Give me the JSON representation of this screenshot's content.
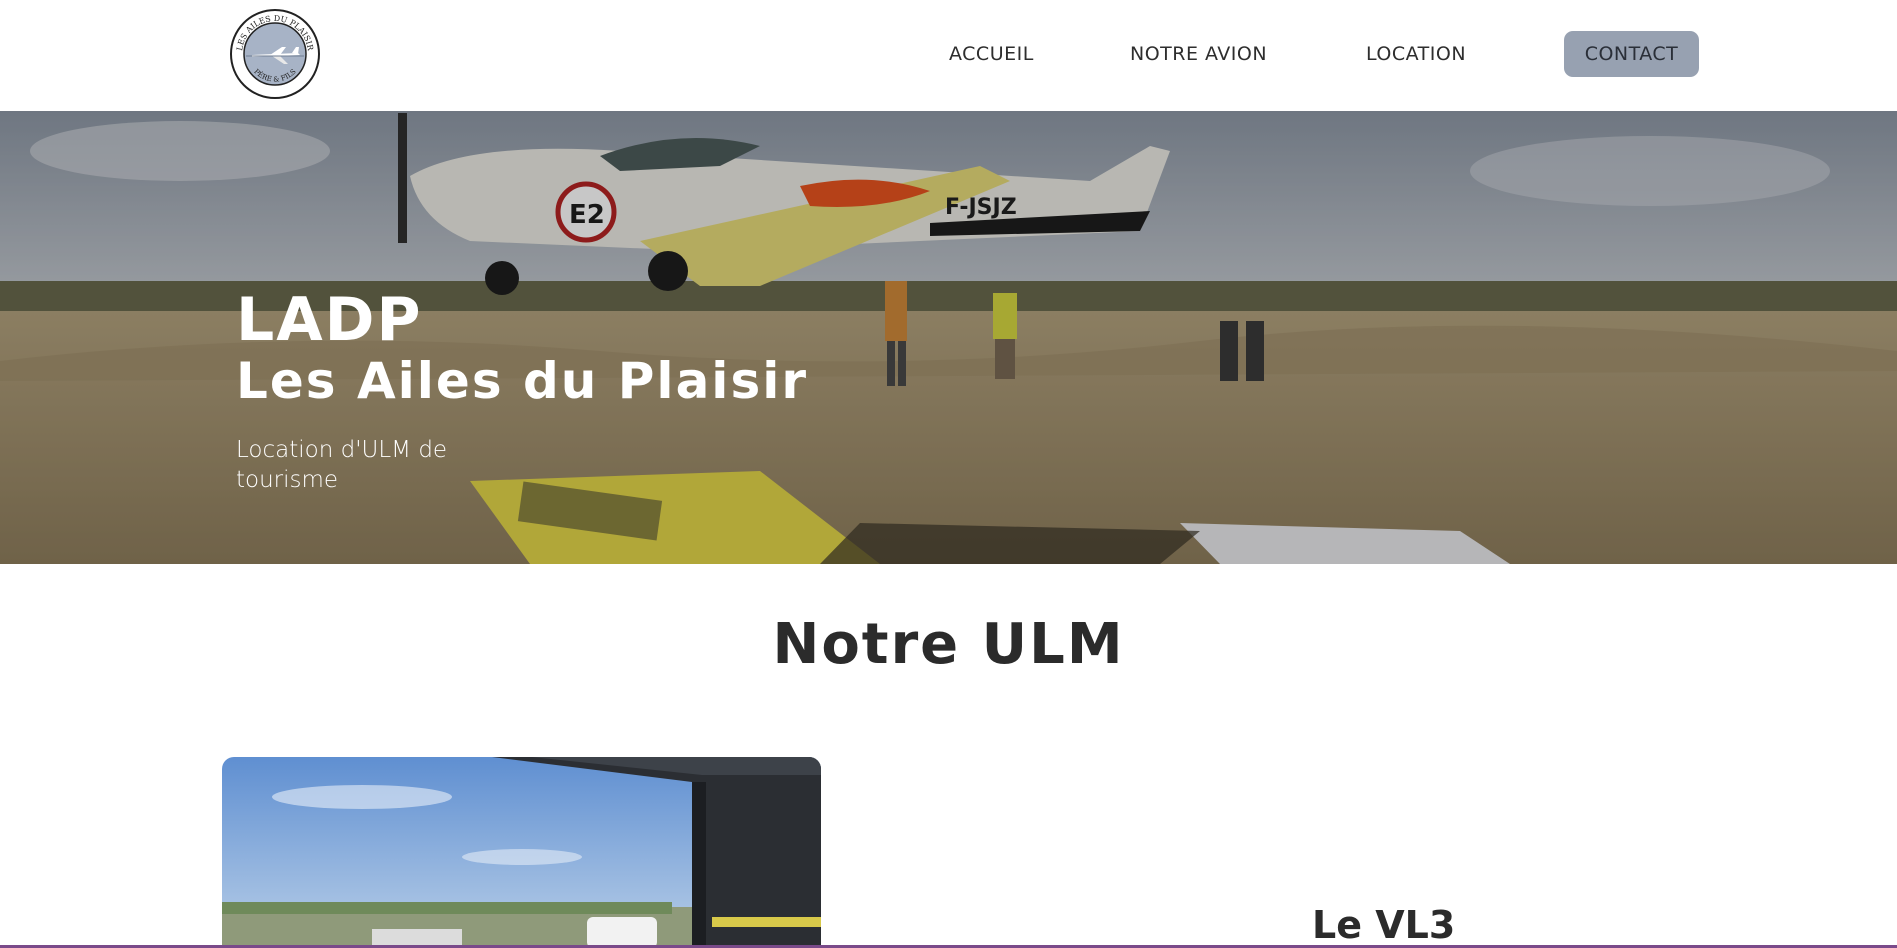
{
  "header": {
    "logo": {
      "icon": "logo-emblem-icon",
      "top_text": "LES AILES DU PLAISIR",
      "bottom_text": "PÈRE & FILS"
    },
    "nav": [
      {
        "label": "ACCUEIL"
      },
      {
        "label": "NOTRE AVION"
      },
      {
        "label": "LOCATION"
      },
      {
        "label": "CONTACT",
        "active": true
      }
    ],
    "accent_color": "#97a1b1"
  },
  "hero": {
    "title": "LADP",
    "subtitle": "Les Ailes du Plaisir",
    "tagline": "Location d'ULM de tourisme",
    "image_icon": "aircraft-takeoff-photo"
  },
  "section": {
    "title": "Notre ULM",
    "photo_icon": "hangar-aircraft-photo",
    "plane_name": "Le VL3"
  }
}
